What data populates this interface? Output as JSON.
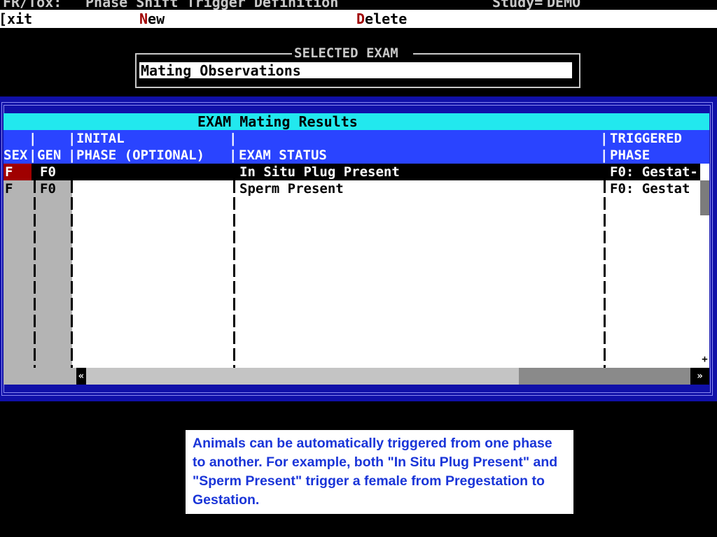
{
  "title_bar": {
    "app": "FR/Tox:",
    "screen": "Phase Shift Trigger Definition",
    "study_label": "Study=",
    "study_value": "DEMO"
  },
  "menu": {
    "exit_bracket": "[",
    "exit_rest": "xit",
    "new_hot": "N",
    "new_rest": "ew",
    "delete_hot": "D",
    "delete_rest": "elete"
  },
  "selected_exam": {
    "legend": "SELECTED EXAM",
    "value": "Mating Observations"
  },
  "results": {
    "title": "EXAM Mating Results",
    "headers": {
      "sex": "SEX",
      "gen": "GEN",
      "initial_phase_line1": "INITAL",
      "initial_phase_line2": "PHASE (OPTIONAL)",
      "exam_status": "EXAM STATUS",
      "triggered_phase_line1": "TRIGGERED",
      "triggered_phase_line2": "PHASE"
    },
    "rows": [
      {
        "sex": "F",
        "gen": "F0",
        "initial_phase": "",
        "exam_status": "In Situ Plug Present",
        "triggered_phase": "F0: Gestat-"
      },
      {
        "sex": "F",
        "gen": "F0",
        "initial_phase": "",
        "exam_status": "Sperm Present",
        "triggered_phase": "F0: Gestat"
      }
    ],
    "scroll": {
      "left_arrow": "«",
      "right_arrow": "»",
      "plus": "+"
    }
  },
  "caption": "Animals can be automatically triggered from one phase to another.  For example, both \"In Situ Plug Present\" and \"Sperm Present\" trigger a female from Pregestation to Gestation.",
  "colors": {
    "background": "#000000",
    "panel_blue": "#1010a8",
    "title_cyan": "#22e8ee",
    "header_blue": "#2a44ff",
    "hotkey_red": "#a00000",
    "caption_blue": "#1a35d8"
  }
}
